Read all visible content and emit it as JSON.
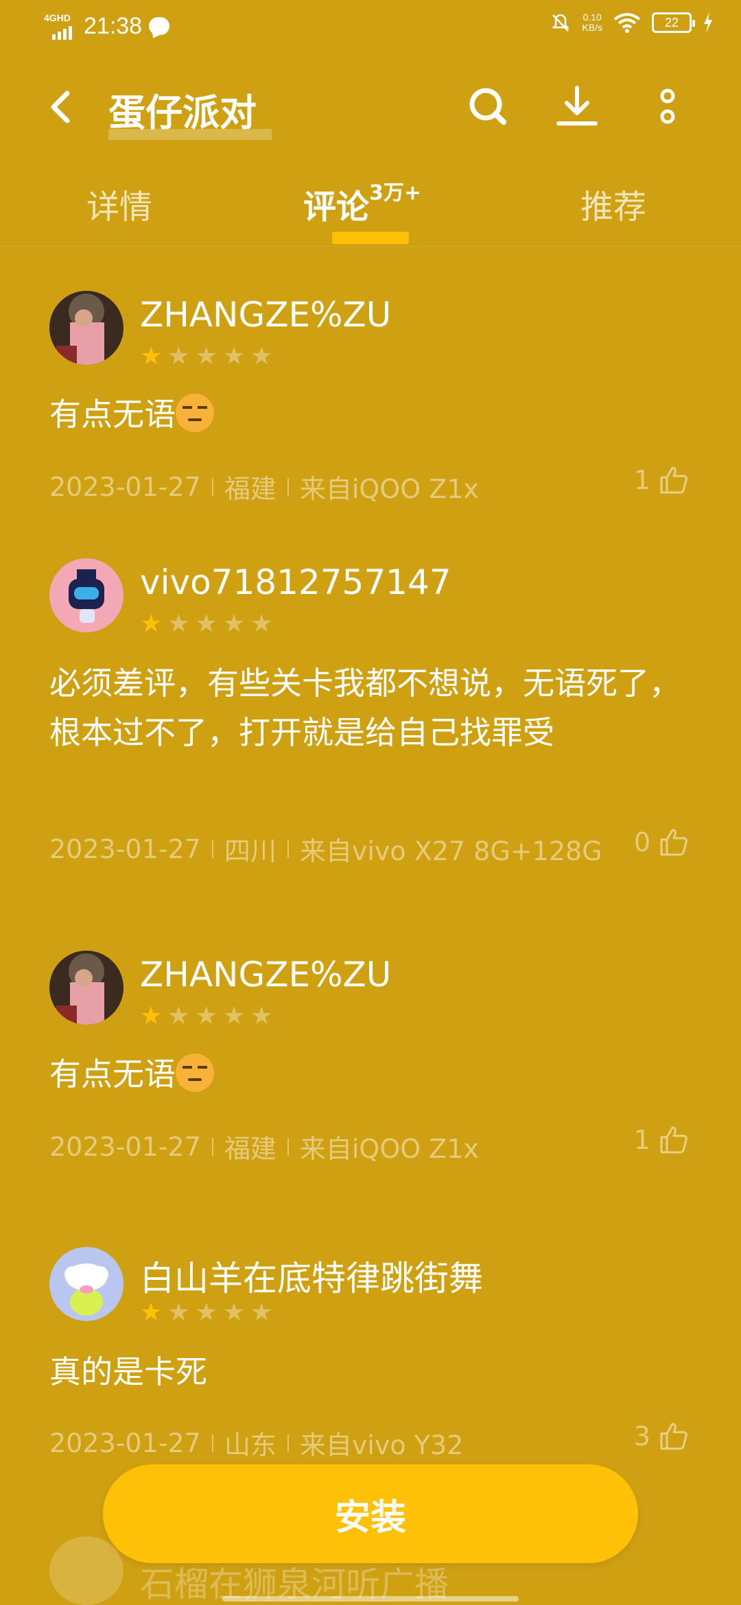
{
  "status_bar": {
    "network": "4GHD",
    "time": "21:38",
    "speed_value": "0.10",
    "speed_unit": "KB/s",
    "battery": "22"
  },
  "header": {
    "title": "蛋仔派对"
  },
  "tabs": [
    {
      "label": "详情"
    },
    {
      "label": "评论",
      "badge": "3万+"
    },
    {
      "label": "推荐"
    }
  ],
  "reviews": [
    {
      "user": "ZHANGZE%ZU",
      "rating": 1,
      "text": "有点无语",
      "date": "2023-01-27",
      "region": "福建",
      "device": "来自iQOO Z1x",
      "likes": "1"
    },
    {
      "user": "vivo71812757147",
      "rating": 1,
      "text": "必须差评，有些关卡我都不想说，无语死了，根本过不了，打开就是给自己找罪受",
      "date": "2023-01-27",
      "region": "四川",
      "device": "来自vivo X27 8G+128G",
      "likes": "0"
    },
    {
      "user": "ZHANGZE%ZU",
      "rating": 1,
      "text": "有点无语",
      "date": "2023-01-27",
      "region": "福建",
      "device": "来自iQOO Z1x",
      "likes": "1"
    },
    {
      "user": "白山羊在底特律跳街舞",
      "rating": 1,
      "text": "真的是卡死",
      "date": "2023-01-27",
      "region": "山东",
      "device": "来自vivo Y32",
      "likes": "3"
    }
  ],
  "partial_user": "石榴在狮泉河听广播",
  "install_label": "安装",
  "colors": {
    "background": "#CFA011",
    "accent": "#FFC107"
  }
}
